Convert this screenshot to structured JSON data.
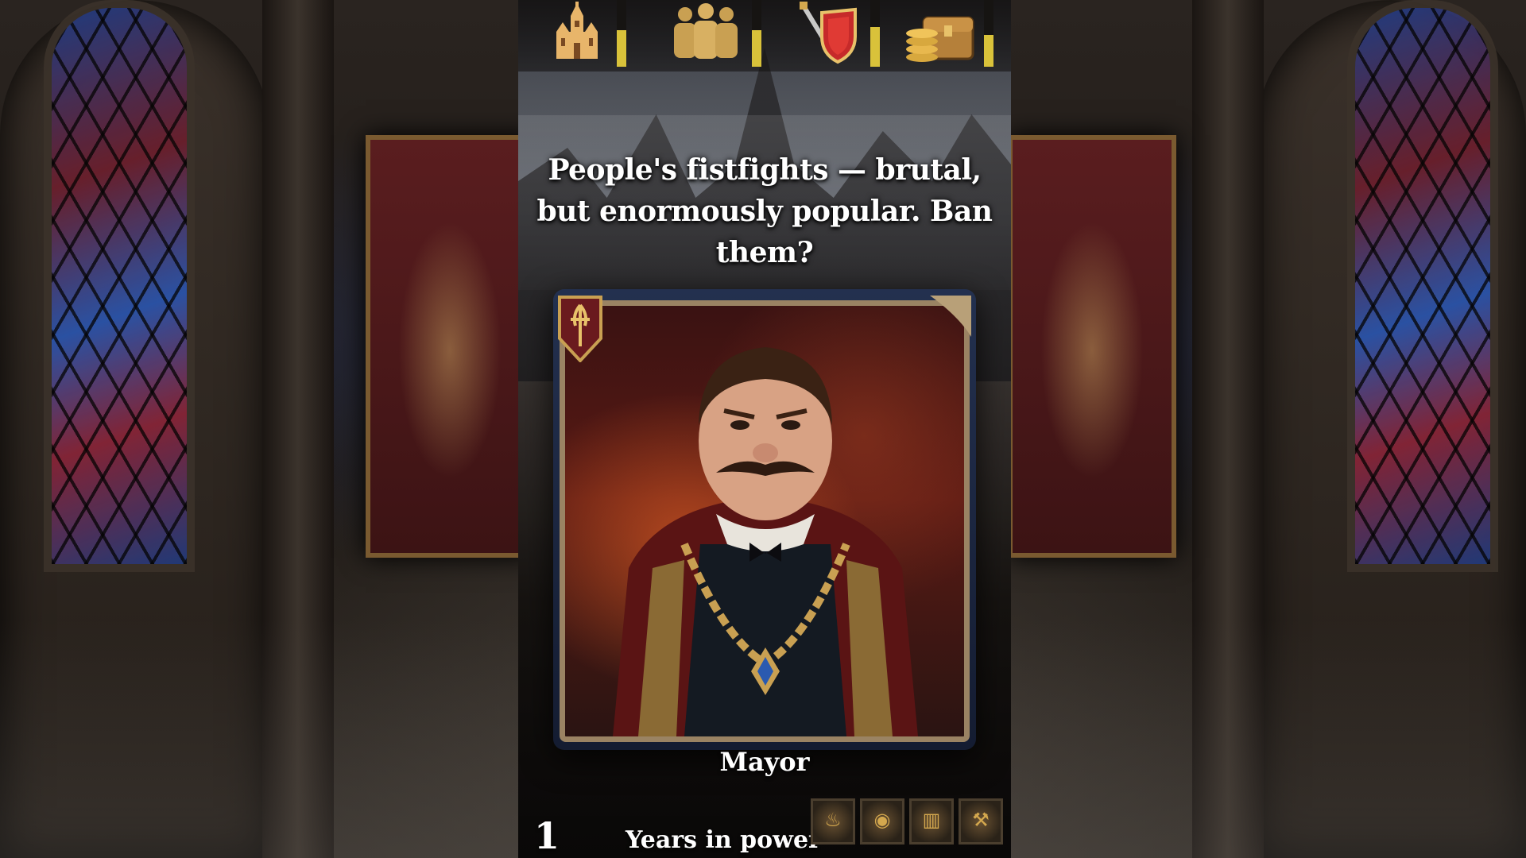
{
  "question": "People's fistfights — brutal, but enormously popular. Ban them?",
  "character": {
    "name": "Mayor"
  },
  "stats": [
    {
      "name": "church",
      "icon": "cathedral-icon",
      "level": 0.55
    },
    {
      "name": "people",
      "icon": "crowd-icon",
      "level": 0.55
    },
    {
      "name": "army",
      "icon": "sword-shield-icon",
      "level": 0.6
    },
    {
      "name": "treasury",
      "icon": "treasure-chest-icon",
      "level": 0.48
    }
  ],
  "years": {
    "value": "1",
    "label": "Years in power"
  },
  "inventory": [
    {
      "icon": "lantern-icon",
      "glyph": "♨"
    },
    {
      "icon": "bread-icon",
      "glyph": "◉"
    },
    {
      "icon": "scroll-icon",
      "glyph": "▥"
    },
    {
      "icon": "tool-icon",
      "glyph": "⚒"
    }
  ],
  "colors": {
    "meter_fill": "#d9c23a",
    "card_border": "#9a8363",
    "card_back": "#1c2640",
    "text": "#ffffff"
  }
}
